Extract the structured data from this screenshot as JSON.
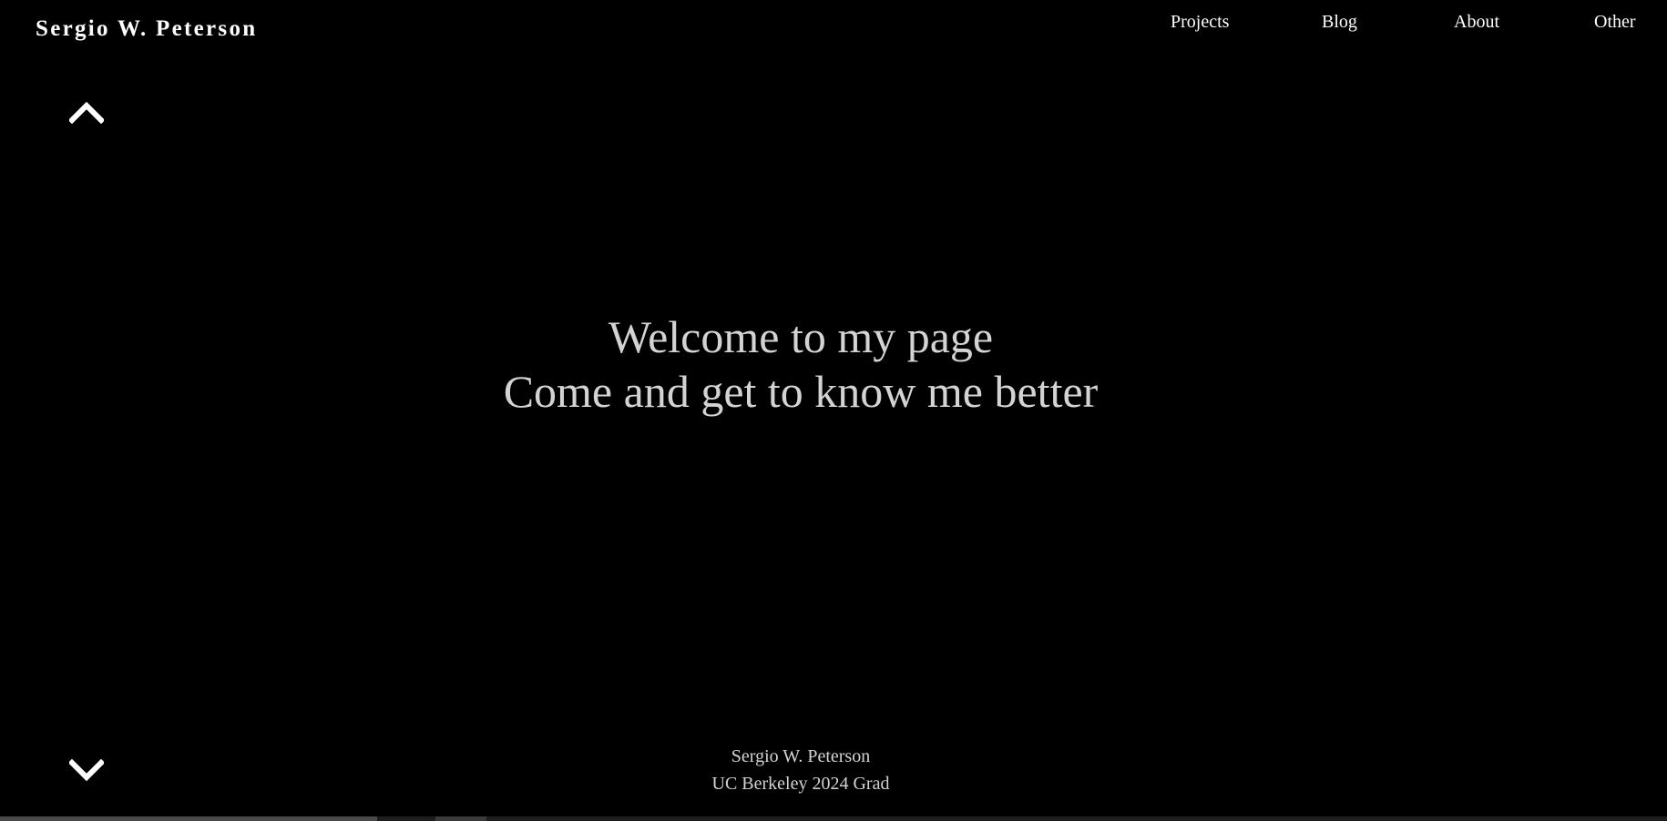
{
  "header": {
    "site_title": "Sergio W. Peterson"
  },
  "nav": {
    "items": [
      {
        "label": "Projects"
      },
      {
        "label": "Blog"
      },
      {
        "label": "About"
      },
      {
        "label": "Other"
      }
    ]
  },
  "hero": {
    "line1": "Welcome to my page",
    "line2": "Come and get to know me better"
  },
  "footer": {
    "name": "Sergio W. Peterson",
    "tagline": "UC Berkeley 2024 Grad"
  },
  "icons": {
    "scroll_up": "chevron-up-icon",
    "scroll_down": "chevron-down-icon"
  },
  "colors": {
    "background": "#000000",
    "heading_text": "#ffffff",
    "body_text": "#d3d3d3"
  }
}
